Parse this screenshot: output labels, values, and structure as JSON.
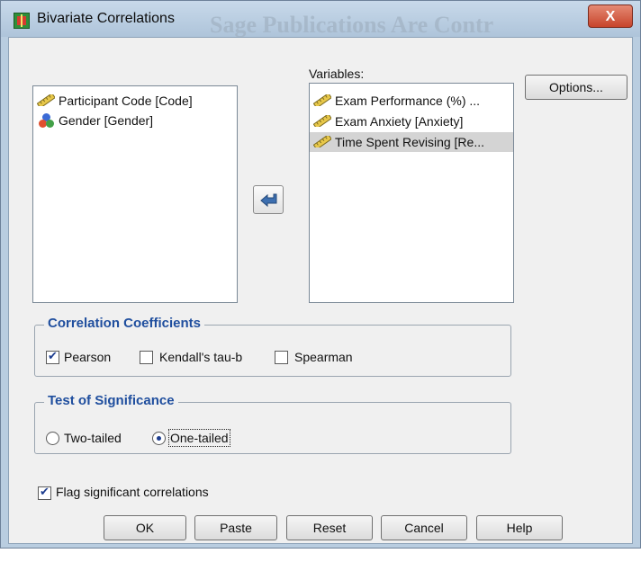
{
  "window": {
    "title": "Bivariate Correlations",
    "watermark": "Sage Publications Are Contr",
    "close_glyph": "X"
  },
  "source_list": {
    "items": [
      {
        "label": "Participant Code [Code]",
        "icon": "scale-ruler-icon"
      },
      {
        "label": "Gender [Gender]",
        "icon": "nominal-balls-icon"
      }
    ]
  },
  "variables": {
    "label": "Variables:",
    "items": [
      {
        "label": "Exam Performance (%) ...",
        "icon": "scale-ruler-icon",
        "selected": false
      },
      {
        "label": "Exam Anxiety [Anxiety]",
        "icon": "scale-ruler-icon",
        "selected": false
      },
      {
        "label": "Time Spent Revising [Re...",
        "icon": "scale-ruler-icon",
        "selected": true
      }
    ]
  },
  "move_button": {
    "icon": "move-left-arrow-icon"
  },
  "options_button": "Options...",
  "correlation": {
    "title": "Correlation Coefficients",
    "pearson": {
      "label": "Pearson",
      "checked": true
    },
    "kendall": {
      "label": "Kendall's tau-b",
      "checked": false
    },
    "spearman": {
      "label": "Spearman",
      "checked": false
    }
  },
  "significance": {
    "title": "Test of Significance",
    "two_tailed": {
      "label": "Two-tailed",
      "selected": false
    },
    "one_tailed": {
      "label": "One-tailed",
      "selected": true
    }
  },
  "flag": {
    "label": "Flag significant correlations",
    "checked": true
  },
  "buttons": {
    "ok": "OK",
    "paste": "Paste",
    "reset": "Reset",
    "cancel": "Cancel",
    "help": "Help"
  },
  "colors": {
    "section_title": "#1f4e9e",
    "selected_row": "#d4d4d4",
    "close_button": "#c7442b",
    "titlebar": "#b9cde0"
  }
}
